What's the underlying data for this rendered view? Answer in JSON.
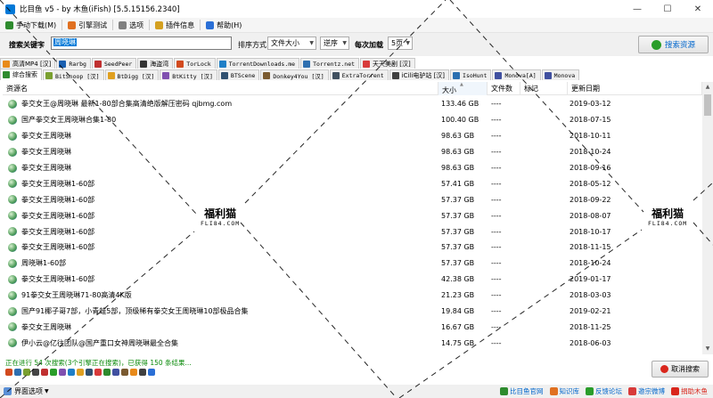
{
  "window": {
    "title": "比目鱼 v5 - by 木鱼(iFish) [5.5.15156.2340]"
  },
  "menu": [
    {
      "label": "手动下载(M)",
      "icon_color": "#2e8b2e"
    },
    {
      "label": "引擎测试",
      "icon_color": "#e07020"
    },
    {
      "label": "选项",
      "icon_color": "#808080"
    },
    {
      "label": "插件信息",
      "icon_color": "#d4a020"
    },
    {
      "label": "帮助(H)",
      "icon_color": "#2a6fd6"
    }
  ],
  "search": {
    "keyword_label": "搜索关键字",
    "keyword_value": "周晓琳",
    "sort_label": "排序方式",
    "sort_value": "文件大小",
    "order_value": "逆序",
    "batch_label": "每次加载",
    "batch_value": "5页",
    "search_button": "搜索资源"
  },
  "tabs_row1": [
    {
      "label": "高清MP4 [汉]",
      "color": "#e88a1a",
      "mono": false
    },
    {
      "label": "Rarbg",
      "color": "#1a5fb0",
      "mono": true
    },
    {
      "label": "SeedPeer",
      "color": "#c03030",
      "mono": true
    },
    {
      "label": "海盗湾",
      "color": "#333333",
      "mono": false
    },
    {
      "label": "TorLock",
      "color": "#d24a1e",
      "mono": true
    },
    {
      "label": "TorrentDownloads.me",
      "color": "#1f7fc7",
      "mono": true
    },
    {
      "label": "Torrentz.net",
      "color": "#2e6fb0",
      "mono": true
    },
    {
      "label": "天天美剧 [汉]",
      "color": "#d83a3a",
      "mono": false
    }
  ],
  "tabs_row2": [
    {
      "label": "综合搜索",
      "color": "#2e8b2e",
      "mono": false,
      "active": true
    },
    {
      "label": "BitSnoop [汉]",
      "color": "#7aa030",
      "mono": true,
      "active": false
    },
    {
      "label": "BtDigg [汉]",
      "color": "#e0a020",
      "mono": true,
      "active": false
    },
    {
      "label": "BtKitty [汉]",
      "color": "#8050b0",
      "mono": true,
      "active": false
    },
    {
      "label": "BTScene",
      "color": "#305070",
      "mono": true,
      "active": false
    },
    {
      "label": "Donkey4You [汉]",
      "color": "#7a5a30",
      "mono": true,
      "active": false
    },
    {
      "label": "ExtraTorrent",
      "color": "#405060",
      "mono": true,
      "active": false
    },
    {
      "label": "iCili电驴站 [汉]",
      "color": "#404040",
      "mono": false,
      "active": false
    },
    {
      "label": "IsoHunt",
      "color": "#2a6fb0",
      "mono": true,
      "active": false
    },
    {
      "label": "Monova[A]",
      "color": "#4050a0",
      "mono": true,
      "active": false
    },
    {
      "label": "Monova",
      "color": "#4050a0",
      "mono": true,
      "active": false
    }
  ],
  "columns": {
    "name": "资源名",
    "size": "大小",
    "count": "文件数",
    "tag": "标记",
    "date": "更新日期"
  },
  "rows": [
    {
      "name": "拳交女王@周晓琳 最新1-80部合集高清绝版解压密码 qjbmg.com",
      "size": "133.46 GB",
      "count": "----",
      "date": "2019-03-12"
    },
    {
      "name": "国产拳交女王周晓琳合集1-80",
      "size": "100.40 GB",
      "count": "----",
      "date": "2018-07-15"
    },
    {
      "name": "拳交女王周晓琳",
      "size": "98.63 GB",
      "count": "----",
      "date": "2018-10-11"
    },
    {
      "name": "拳交女王周晓琳",
      "size": "98.63 GB",
      "count": "----",
      "date": "2018-10-24"
    },
    {
      "name": "拳交女王周晓琳",
      "size": "98.63 GB",
      "count": "----",
      "date": "2018-09-16"
    },
    {
      "name": "拳交女王周晓琳1-60部",
      "size": "57.41 GB",
      "count": "----",
      "date": "2018-05-12"
    },
    {
      "name": "拳交女王周晓琳1-60部",
      "size": "57.37 GB",
      "count": "----",
      "date": "2018-09-22"
    },
    {
      "name": "拳交女王周晓琳1-60部",
      "size": "57.37 GB",
      "count": "----",
      "date": "2018-08-07"
    },
    {
      "name": "拳交女王周晓琳1-60部",
      "size": "57.37 GB",
      "count": "----",
      "date": "2018-10-17"
    },
    {
      "name": "拳交女王周晓琳1-60部",
      "size": "57.37 GB",
      "count": "----",
      "date": "2018-11-15"
    },
    {
      "name": "周晓琳1-60部",
      "size": "57.37 GB",
      "count": "----",
      "date": "2018-10-24"
    },
    {
      "name": "拳交女王周晓琳1-60部",
      "size": "42.38 GB",
      "count": "----",
      "date": "2019-01-17"
    },
    {
      "name": "91拳交女王周晓琳71-80高清4K版",
      "size": "21.23 GB",
      "count": "----",
      "date": "2018-03-03"
    },
    {
      "name": "国产91椰子哥7部，小青蛙5部，顶级稀有拳交女王周晓琳10部极品合集",
      "size": "19.84 GB",
      "count": "----",
      "date": "2019-02-21"
    },
    {
      "name": "拳交女王周晓琳",
      "size": "16.67 GB",
      "count": "----",
      "date": "2018-11-25"
    },
    {
      "name": "伊小云@亿往团队@国产重口女神周晓琳最全合集",
      "size": "14.75 GB",
      "count": "----",
      "date": "2018-06-03"
    }
  ],
  "status": {
    "text": "正在进行 54 次搜索(3个引擎正在搜索)，已获得 150 条结果..."
  },
  "cancel_button": "取消搜索",
  "engine_icon_colors": [
    "#d24a1e",
    "#2e6fb0",
    "#7aa030",
    "#444",
    "#c03030",
    "#2a9d2a",
    "#8050b0",
    "#1f7fc7",
    "#e0a020",
    "#305070",
    "#d83a3a",
    "#2e8b2e",
    "#4050a0",
    "#7a5a30",
    "#e88a1a",
    "#404040",
    "#2a6fd6"
  ],
  "bottom": {
    "ui_options": "界面选项",
    "links": [
      {
        "label": "比目鱼官网",
        "color": "#2e8b2e"
      },
      {
        "label": "知识库",
        "color": "#e07020"
      },
      {
        "label": "反馈论坛",
        "color": "#2a9d2a"
      },
      {
        "label": "邀宗微博",
        "color": "#d83a3a"
      },
      {
        "label": "捐助木鱼",
        "color": "#d9261c"
      }
    ]
  },
  "watermark": {
    "line1": "福利猫",
    "line2": "FLI84.COM"
  }
}
